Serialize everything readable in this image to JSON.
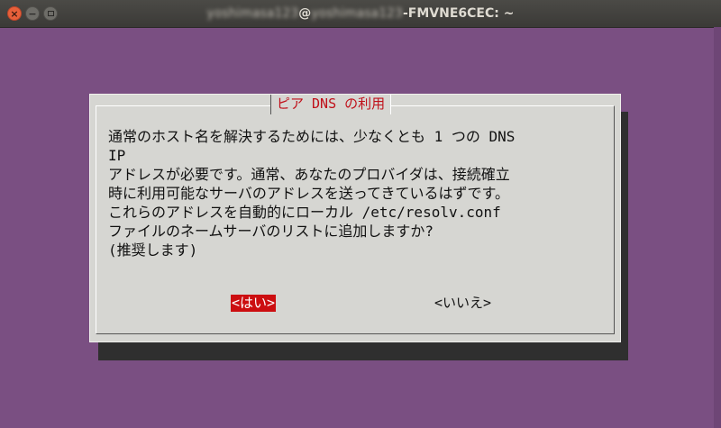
{
  "window": {
    "title_hidden_user": "yoshimasa123",
    "title_hidden_host": "yoshimasa123",
    "title_suffix": "-FMVNE6CEC: ~",
    "title_at": "@",
    "controls": {
      "close_glyph": "×",
      "minimize_glyph": "−"
    }
  },
  "dialog": {
    "title": "ピア DNS の利用",
    "lines": [
      "通常のホスト名を解決するためには、少なくとも 1 つの DNS",
      "IP",
      "アドレスが必要です。通常、あなたのプロバイダは、接続確立",
      "時に利用可能なサーバのアドレスを送ってきているはずです。",
      "これらのアドレスを自動的にローカル /etc/resolv.conf",
      "ファイルのネームサーバのリストに追加しますか?",
      "(推奨します)"
    ],
    "buttons": {
      "yes": "<はい>",
      "no": "<いいえ>"
    }
  },
  "colors": {
    "desktop": "#7a4f82",
    "dialog_bg": "#d6d6d2",
    "accent_red": "#cc0e10",
    "shadow": "#2f2f2f"
  }
}
